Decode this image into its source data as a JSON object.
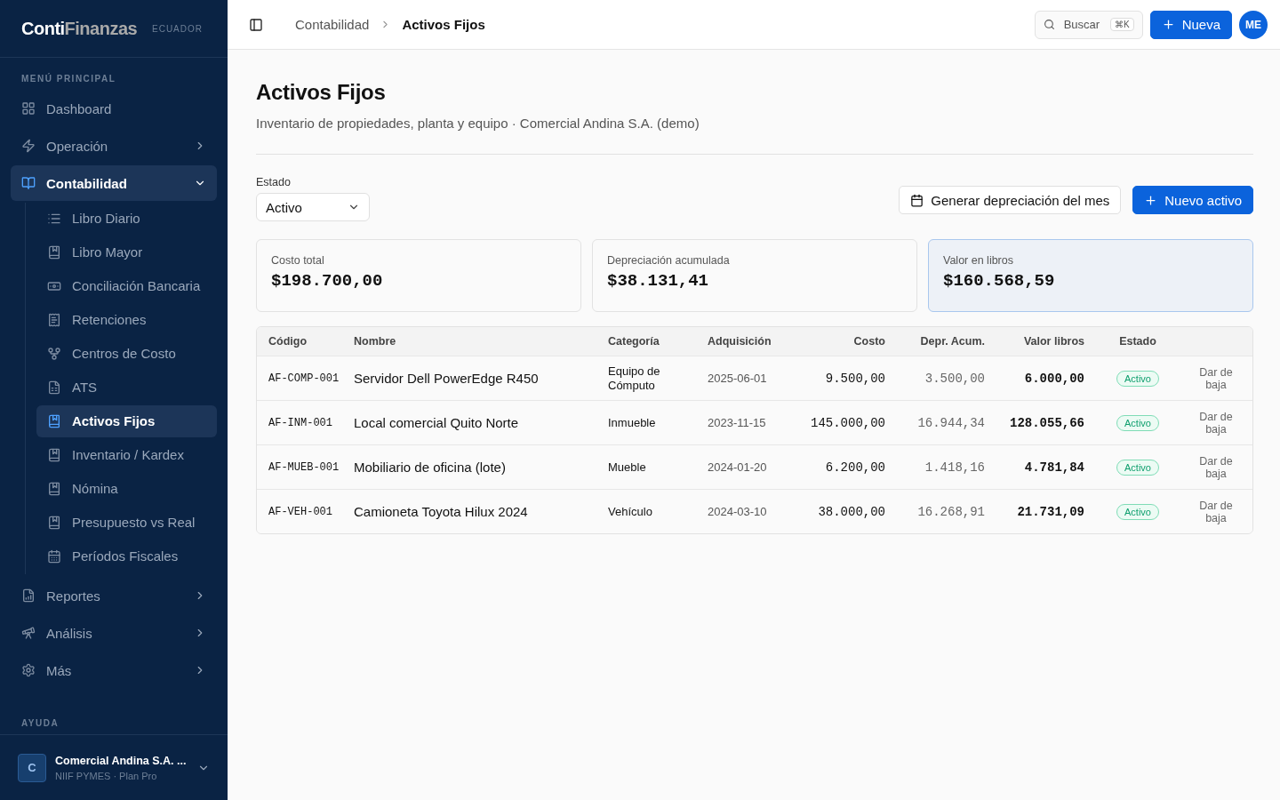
{
  "sidebar": {
    "logo_primary": "Conti",
    "logo_secondary": "Finanzas",
    "region": "ECUADOR",
    "section_label": "MENÚ PRINCIPAL",
    "items": [
      {
        "label": "Dashboard",
        "selected": false
      },
      {
        "label": "Operación",
        "selected": false,
        "expanded": false
      },
      {
        "label": "Contabilidad",
        "selected": true,
        "expanded": true,
        "children": [
          {
            "label": "Libro Diario",
            "selected": false
          },
          {
            "label": "Libro Mayor",
            "selected": false
          },
          {
            "label": "Conciliación Bancaria",
            "selected": false
          },
          {
            "label": "Retenciones",
            "selected": false
          },
          {
            "label": "Centros de Costo",
            "selected": false
          },
          {
            "label": "ATS",
            "selected": false
          },
          {
            "label": "Activos Fijos",
            "selected": true
          },
          {
            "label": "Inventario / Kardex",
            "selected": false
          },
          {
            "label": "Nómina",
            "selected": false
          },
          {
            "label": "Presupuesto vs Real",
            "selected": false
          },
          {
            "label": "Períodos Fiscales",
            "selected": false
          }
        ]
      },
      {
        "label": "Reportes",
        "selected": false,
        "expanded": false
      },
      {
        "label": "Análisis",
        "selected": false,
        "expanded": false
      },
      {
        "label": "Más",
        "selected": false,
        "expanded": false
      }
    ],
    "help_label": "AYUDA",
    "company": {
      "initial": "C",
      "name": "Comercial Andina S.A. ...",
      "plan": "NIIF PYMES · Plan Pro"
    }
  },
  "topbar": {
    "breadcrumb": [
      "Contabilidad",
      "Activos Fijos"
    ],
    "search": {
      "placeholder": "Buscar",
      "shortcut": "⌘K"
    },
    "new_button": "Nueva",
    "avatar": "ME"
  },
  "page": {
    "title": "Activos Fijos",
    "subtitle": "Inventario de propiedades, planta y equipo · Comercial Andina S.A. (demo)",
    "filter": {
      "label": "Estado",
      "value": "Activo"
    },
    "actions": [
      {
        "label": "Generar depreciación del mes",
        "kind": "secondary"
      },
      {
        "label": "Nuevo activo",
        "kind": "primary"
      }
    ],
    "stats": [
      {
        "label": "Costo total",
        "value": "$198.700,00",
        "highlighted": false
      },
      {
        "label": "Depreciación acumulada",
        "value": "$38.131,41",
        "highlighted": false
      },
      {
        "label": "Valor en libros",
        "value": "$160.568,59",
        "highlighted": true
      }
    ]
  },
  "table": {
    "columns": [
      "Código",
      "Nombre",
      "Categoría",
      "Adquisición",
      "Costo",
      "Depr. Acum.",
      "Valor libros",
      "Estado"
    ],
    "rows": [
      {
        "code": "AF-COMP-001",
        "name": "Servidor Dell PowerEdge R450",
        "category": "Equipo de Cómputo",
        "date": "2025-06-01",
        "cost": "9.500,00",
        "depreciation": "3.500,00",
        "book_value": "6.000,00",
        "status": "Activo",
        "action": "Dar de baja"
      },
      {
        "code": "AF-INM-001",
        "name": "Local comercial Quito Norte",
        "category": "Inmueble",
        "date": "2023-11-15",
        "cost": "145.000,00",
        "depreciation": "16.944,34",
        "book_value": "128.055,66",
        "status": "Activo",
        "action": "Dar de baja"
      },
      {
        "code": "AF-MUEB-001",
        "name": "Mobiliario de oficina (lote)",
        "category": "Mueble",
        "date": "2024-01-20",
        "cost": "6.200,00",
        "depreciation": "1.418,16",
        "book_value": "4.781,84",
        "status": "Activo",
        "action": "Dar de baja"
      },
      {
        "code": "AF-VEH-001",
        "name": "Camioneta Toyota Hilux 2024",
        "category": "Vehículo",
        "date": "2024-03-10",
        "cost": "38.000,00",
        "depreciation": "16.268,91",
        "book_value": "21.731,09",
        "status": "Activo",
        "action": "Dar de baja"
      }
    ]
  }
}
